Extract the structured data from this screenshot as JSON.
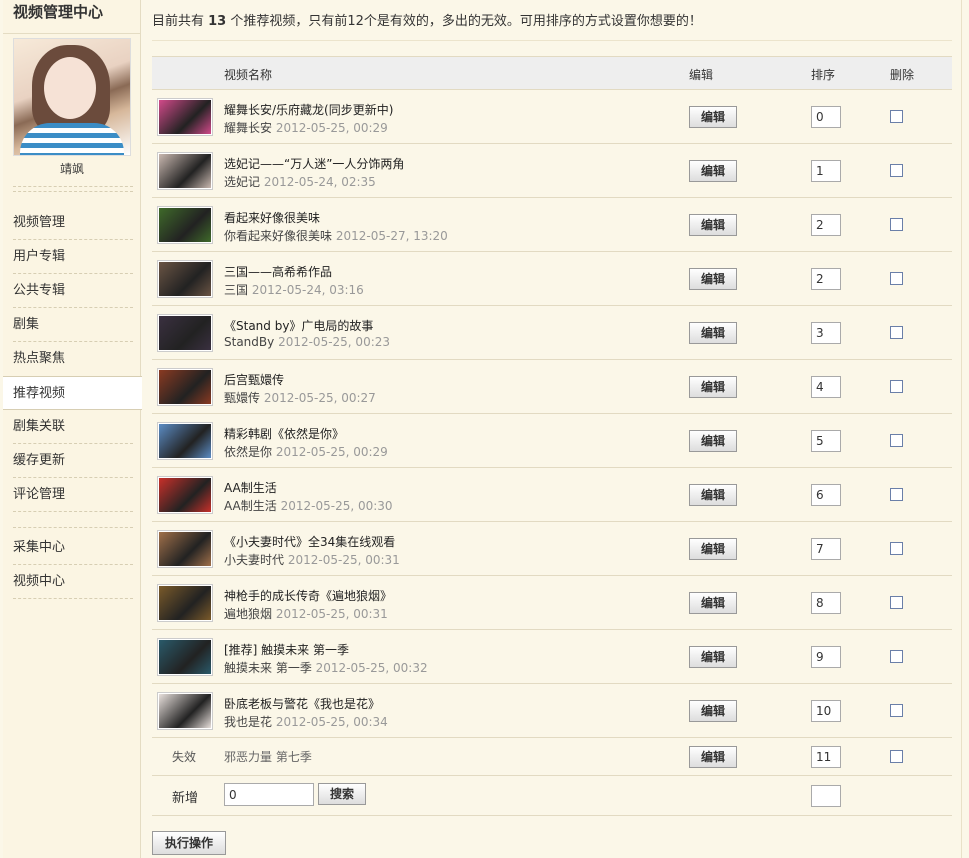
{
  "sidebar": {
    "title": "视频管理中心",
    "username": "靖飒",
    "items": [
      {
        "label": "视频管理",
        "active": false
      },
      {
        "label": "用户专辑",
        "active": false
      },
      {
        "label": "公共专辑",
        "active": false
      },
      {
        "label": "剧集",
        "active": false
      },
      {
        "label": "热点聚焦",
        "active": false
      },
      {
        "label": "推荐视频",
        "active": true
      },
      {
        "label": "剧集关联",
        "active": false
      },
      {
        "label": "缓存更新",
        "active": false
      },
      {
        "label": "评论管理",
        "active": false
      },
      {
        "label": "采集中心",
        "active": false
      },
      {
        "label": "视频中心",
        "active": false
      }
    ]
  },
  "notice": {
    "prefix": "目前共有 ",
    "count": "13",
    "suffix": " 个推荐视频，只有前12个是有效的，多出的无效。可用排序的方式设置你想要的！"
  },
  "table": {
    "headers": {
      "name": "视频名称",
      "edit": "编辑",
      "sort": "排序",
      "delete": "删除"
    },
    "edit_label": "编辑",
    "rows": [
      {
        "title": "耀舞长安/乐府藏龙(同步更新中)",
        "subtitle": "耀舞长安",
        "date": "2012-05-25, 00:29",
        "sort": "0",
        "thumb_color": "#d24a8a"
      },
      {
        "title": "选妃记——“万人迷”一人分饰两角",
        "subtitle": "选妃记",
        "date": "2012-05-24, 02:35",
        "sort": "1",
        "thumb_color": "#c9b8b0"
      },
      {
        "title": "看起来好像很美味",
        "subtitle": "你看起来好像很美味",
        "date": "2012-05-27, 13:20",
        "sort": "2",
        "thumb_color": "#3f6a2a"
      },
      {
        "title": "三国——高希希作品",
        "subtitle": "三国",
        "date": "2012-05-24, 03:16",
        "sort": "2",
        "thumb_color": "#6a5444"
      },
      {
        "title": "《Stand by》广电局的故事",
        "subtitle": "StandBy",
        "date": "2012-05-25, 00:23",
        "sort": "3",
        "thumb_color": "#3a3040"
      },
      {
        "title": "后宫甄嬛传",
        "subtitle": "甄嬛传",
        "date": "2012-05-25, 00:27",
        "sort": "4",
        "thumb_color": "#8a3a22"
      },
      {
        "title": "精彩韩剧《依然是你》",
        "subtitle": "依然是你",
        "date": "2012-05-25, 00:29",
        "sort": "5",
        "thumb_color": "#5b8cc4"
      },
      {
        "title": "AA制生活",
        "subtitle": "AA制生活",
        "date": "2012-05-25, 00:30",
        "sort": "6",
        "thumb_color": "#c8302a"
      },
      {
        "title": "《小夫妻时代》全34集在线观看",
        "subtitle": "小夫妻时代",
        "date": "2012-05-25, 00:31",
        "sort": "7",
        "thumb_color": "#a0704a"
      },
      {
        "title": "神枪手的成长传奇《遍地狼烟》",
        "subtitle": "遍地狼烟",
        "date": "2012-05-25, 00:31",
        "sort": "8",
        "thumb_color": "#7a5a2a"
      },
      {
        "title": "[推荐] 触摸未来 第一季",
        "subtitle": "触摸未来 第一季",
        "date": "2012-05-25, 00:32",
        "sort": "9",
        "thumb_color": "#2a5a6a"
      },
      {
        "title": "卧底老板与警花《我也是花》",
        "subtitle": "我也是花",
        "date": "2012-05-25, 00:34",
        "sort": "10",
        "thumb_color": "#e8e0dc"
      }
    ],
    "invalid_row": {
      "label": "失效",
      "title": "邪恶力量 第七季",
      "sort": "11"
    },
    "new_row": {
      "label": "新增",
      "input_value": "0",
      "search_label": "搜索",
      "sort": ""
    }
  },
  "exec_button": "执行操作"
}
